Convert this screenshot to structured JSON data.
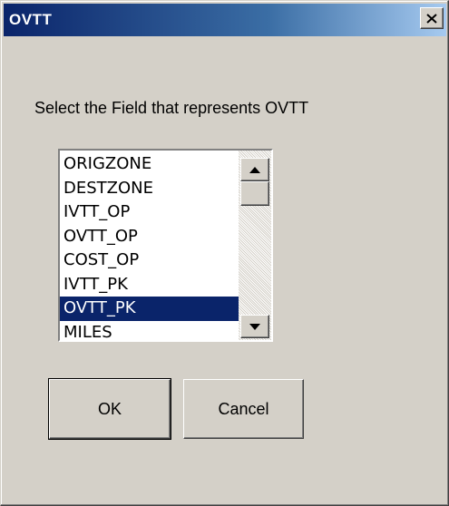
{
  "window": {
    "title": "OVTT",
    "close_glyph": "✕"
  },
  "prompt": "Select the Field that represents OVTT",
  "fields": {
    "items": [
      "ORIGZONE",
      "DESTZONE",
      "IVTT_OP",
      "OVTT_OP",
      "COST_OP",
      "IVTT_PK",
      "OVTT_PK",
      "MILES"
    ],
    "selected": "OVTT_PK"
  },
  "buttons": {
    "ok": "OK",
    "cancel": "Cancel"
  },
  "icons": {
    "close": "close-icon",
    "scroll_up": "arrow-up-icon",
    "scroll_down": "arrow-down-icon"
  },
  "colors": {
    "titlebar_start": "#0a246a",
    "titlebar_end": "#a6caf0",
    "face": "#d4d0c8",
    "selection": "#0a246a"
  }
}
